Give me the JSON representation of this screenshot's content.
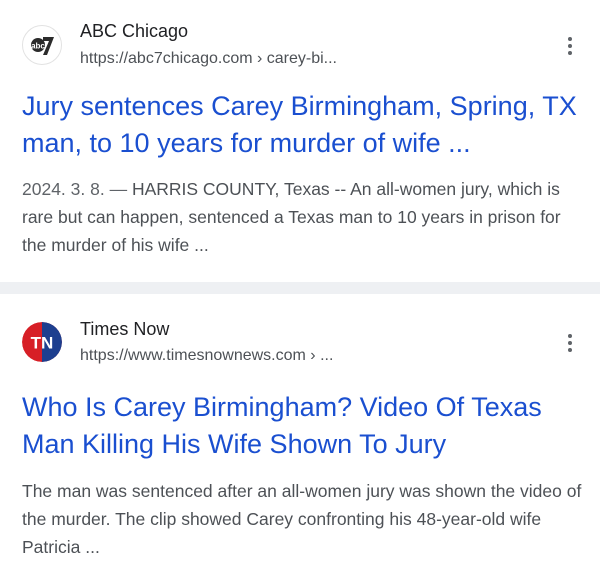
{
  "results": [
    {
      "source_name": "ABC Chicago",
      "url": "https://abc7chicago.com › carey-bi...",
      "favicon": "abc7-logo-icon",
      "title": "Jury sentences Carey Birmingham, Spring, TX man, to 10 years for murder of wife ...",
      "date": "2024. 3. 8. — ",
      "snippet": "HARRIS COUNTY, Texas -- An all-women jury, which is rare but can happen, sentenced a Texas man to 10 years in prison for the murder of his wife ..."
    },
    {
      "source_name": "Times Now",
      "url": "https://www.timesnownews.com › ...",
      "favicon": "times-now-logo-icon",
      "favicon_text": "TN",
      "title": "Who Is Carey Birmingham? Video Of Texas Man Killing His Wife Shown To Jury",
      "snippet": "The man was sentenced after an all-women jury was shown the video of the murder. The clip showed Carey confronting his 48-year-old wife Patricia ..."
    }
  ],
  "colors": {
    "title_link": "#1a4fd0",
    "source_name": "#202124",
    "snippet": "#4d5156",
    "separator": "#eef0f3",
    "times_now_red": "#d71f26",
    "times_now_blue": "#1d3f8f",
    "abc_dark": "#2b2b2b"
  }
}
